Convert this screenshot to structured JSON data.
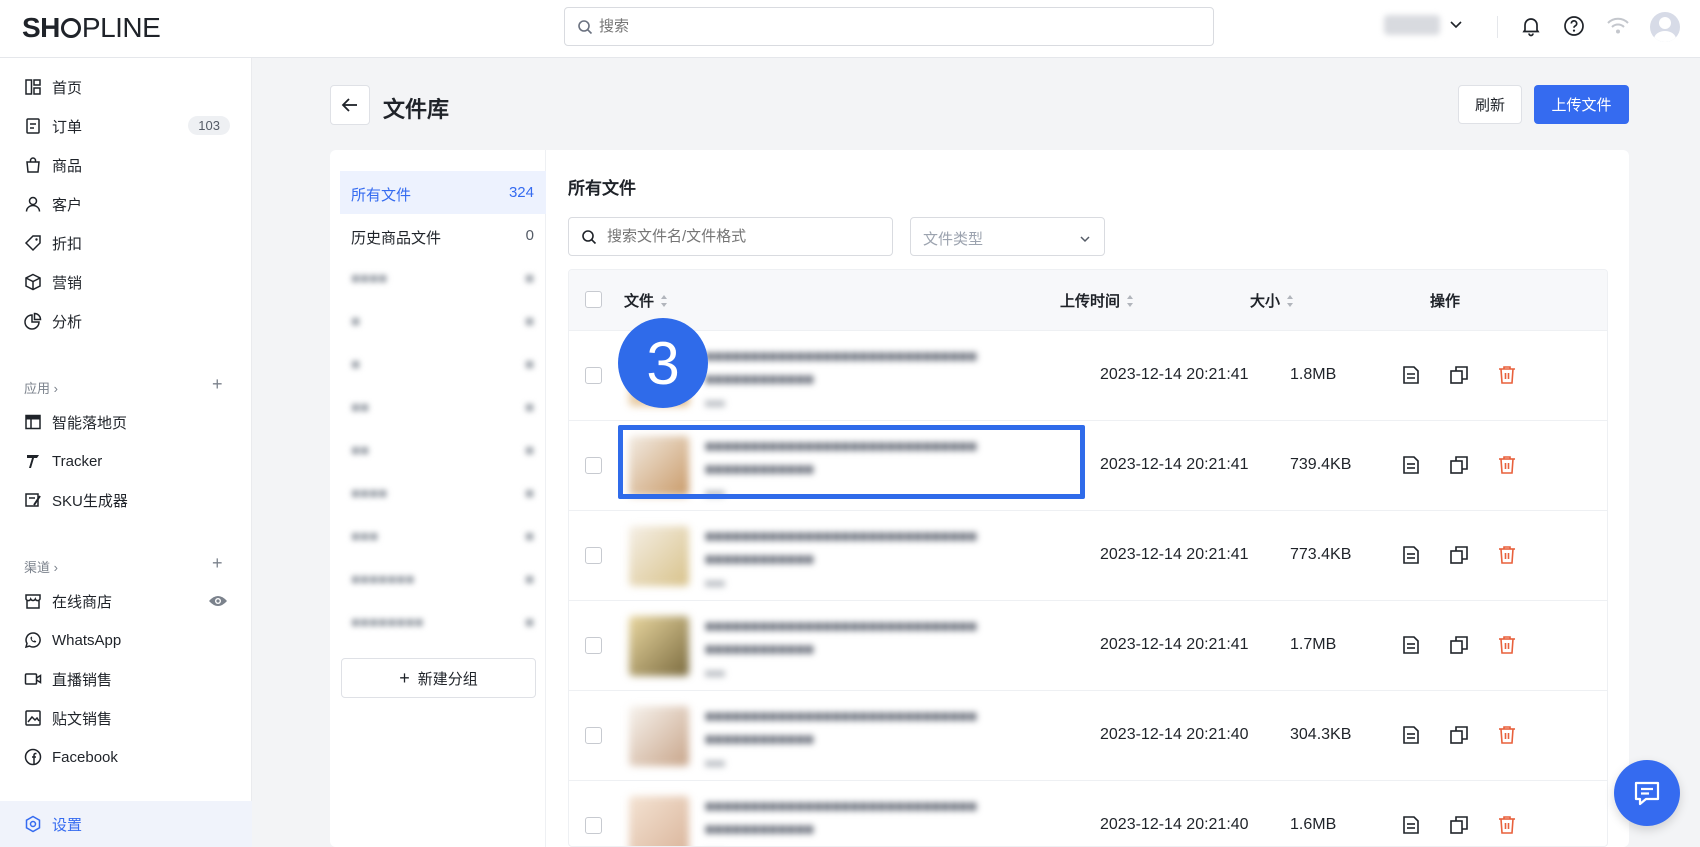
{
  "brand": {
    "logo_a": "SH",
    "logo_b": "PLINE"
  },
  "header": {
    "search_placeholder": "搜索"
  },
  "sidebar": {
    "items": [
      {
        "label": "首页"
      },
      {
        "label": "订单",
        "badge": "103"
      },
      {
        "label": "商品"
      },
      {
        "label": "客户"
      },
      {
        "label": "折扣"
      },
      {
        "label": "营销"
      },
      {
        "label": "分析"
      }
    ],
    "apps_section": "应用 ›",
    "apps": [
      {
        "label": "智能落地页"
      },
      {
        "label": "Tracker"
      },
      {
        "label": "SKU生成器"
      }
    ],
    "channels_section": "渠道 ›",
    "channels": [
      {
        "label": "在线商店"
      },
      {
        "label": "WhatsApp"
      },
      {
        "label": "直播销售"
      },
      {
        "label": "贴文销售"
      },
      {
        "label": "Facebook"
      }
    ],
    "settings": "设置"
  },
  "page": {
    "title": "文件库",
    "refresh": "刷新",
    "upload": "上传文件"
  },
  "groups": [
    {
      "label": "所有文件",
      "count": "324"
    },
    {
      "label": "历史商品文件",
      "count": "0"
    }
  ],
  "new_group": "新建分组",
  "main": {
    "title": "所有文件",
    "search_placeholder": "搜索文件名/文件格式",
    "type_placeholder": "文件类型"
  },
  "table": {
    "headers": {
      "file": "文件",
      "time": "上传时间",
      "size": "大小",
      "actions": "操作"
    },
    "rows": [
      {
        "time": "2023-12-14 20:21:41",
        "size": "1.8MB"
      },
      {
        "time": "2023-12-14 20:21:41",
        "size": "739.4KB"
      },
      {
        "time": "2023-12-14 20:21:41",
        "size": "773.4KB"
      },
      {
        "time": "2023-12-14 20:21:41",
        "size": "1.7MB"
      },
      {
        "time": "2023-12-14 20:21:40",
        "size": "304.3KB"
      },
      {
        "time": "2023-12-14 20:21:40",
        "size": "1.6MB"
      }
    ]
  },
  "overlay": {
    "step": "3"
  },
  "colors": {
    "accent": "#356bf0",
    "danger": "#e8603c",
    "highlight": "#2f6bea"
  }
}
